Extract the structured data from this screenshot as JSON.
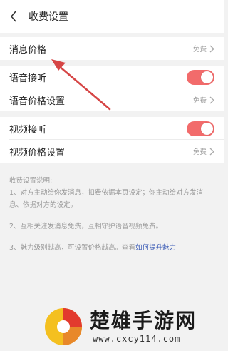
{
  "header": {
    "back_icon": "chevron-left-icon",
    "title": "收费设置"
  },
  "section1": {
    "rows": [
      {
        "label": "消息价格",
        "value": "免费",
        "icon": "chevron-right-icon"
      }
    ]
  },
  "section2": {
    "voice_toggle": {
      "label": "语音接听",
      "on": true
    },
    "voice_price": {
      "label": "语音价格设置",
      "value": "免费",
      "icon": "chevron-right-icon"
    }
  },
  "section3": {
    "video_toggle": {
      "label": "视频接听",
      "on": true
    },
    "video_price": {
      "label": "视频价格设置",
      "value": "免费",
      "icon": "chevron-right-icon"
    }
  },
  "notes": {
    "heading": "收费设置说明:",
    "item1": "1、对方主动给你发消息，扣费依据本页设定；你主动给对方发消息、依据对方的设定。",
    "item2": "2、互相关注发消息免费，互相守护语音视频免费。",
    "item3_prefix": "3、魅力级别越高，可设置价格越高。查看",
    "item3_link": "如何提升魅力"
  },
  "watermark": {
    "name": "楚雄手游网",
    "url": "www.cxcy114.com"
  },
  "colors": {
    "toggle_on": "#f26b6b",
    "link": "#3b5bb5",
    "annotation_arrow": "#d64545"
  }
}
